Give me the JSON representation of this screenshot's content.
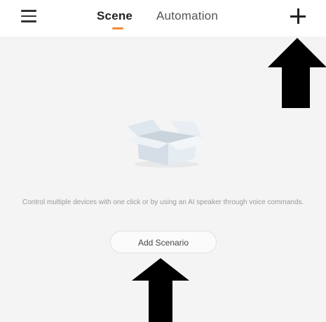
{
  "header": {
    "menu_icon": "hamburger-menu-icon",
    "tabs": [
      {
        "label": "Scene",
        "active": true
      },
      {
        "label": "Automation",
        "active": false
      }
    ],
    "add_icon": "plus-icon",
    "active_indicator_color": "#f08a3a"
  },
  "main": {
    "illustration": "empty-box-illustration",
    "empty_message": "Control multiple devices with one click or by using an AI speaker through voice commands.",
    "add_button_label": "Add Scenario"
  },
  "annotations": {
    "arrow_color": "#000000"
  }
}
